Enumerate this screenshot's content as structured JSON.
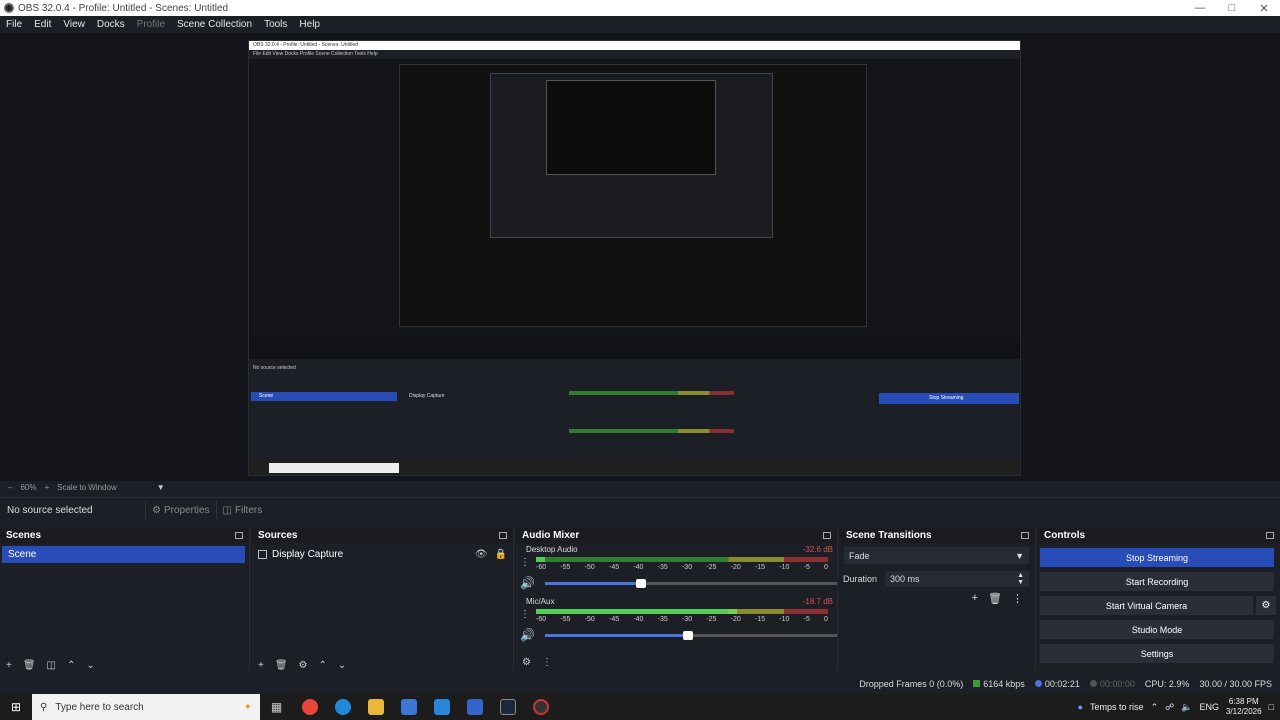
{
  "window": {
    "title": "OBS 32.0.4 - Profile: Untitled - Scenes: Untitled"
  },
  "menu": [
    "File",
    "Edit",
    "View",
    "Docks",
    "Profile",
    "Scene Collection",
    "Tools",
    "Help"
  ],
  "menu_disabled": "Profile",
  "nested_preview": {
    "title": "OBS 32.0.4 - Profile: Untitled - Scenes: Untitled",
    "menu": "File  Edit  View  Docks  Profile  Scene Collection  Tools  Help",
    "no_source": "No source selected",
    "scene": "Scene",
    "source": "Display Capture",
    "stop_streaming": "Stop Streaming"
  },
  "scale": {
    "zoom": "60%",
    "mode": "Scale to Window"
  },
  "context": {
    "no_source": "No source selected",
    "properties": "Properties",
    "filters": "Filters"
  },
  "scenes": {
    "title": "Scenes",
    "items": [
      "Scene"
    ]
  },
  "sources": {
    "title": "Sources",
    "items": [
      "Display Capture"
    ]
  },
  "mixer": {
    "title": "Audio Mixer",
    "channels": [
      {
        "name": "Desktop Audio",
        "db": "-32.6 dB",
        "level": 0.03,
        "volume": 0.33
      },
      {
        "name": "Mic/Aux",
        "db": "-18.7 dB",
        "level": 0.69,
        "volume": 0.49
      }
    ],
    "ticks": [
      "-60",
      "-55",
      "-50",
      "-45",
      "-40",
      "-35",
      "-30",
      "-25",
      "-20",
      "-15",
      "-10",
      "-5",
      "0"
    ]
  },
  "transitions": {
    "title": "Scene Transitions",
    "selected": "Fade",
    "duration_label": "Duration",
    "duration": "300 ms"
  },
  "controls": {
    "title": "Controls",
    "stop_streaming": "Stop Streaming",
    "start_recording": "Start Recording",
    "start_virtual_camera": "Start Virtual Camera",
    "studio_mode": "Studio Mode",
    "settings": "Settings"
  },
  "status": {
    "dropped_frames": "Dropped Frames 0 (0.0%)",
    "bitrate": "6164 kbps",
    "stream_time": "00:02:21",
    "record_time": "00:00:00",
    "cpu": "CPU: 2.9%",
    "fps": "30.00 / 30.00 FPS"
  },
  "taskbar": {
    "search_placeholder": "Type here to search",
    "weather": "Temps to rise",
    "lang": "ENG",
    "time": "6:38 PM",
    "date": "3/12/2026"
  },
  "colors": {
    "accent": "#284cb8",
    "bg": "#1d1f26"
  }
}
